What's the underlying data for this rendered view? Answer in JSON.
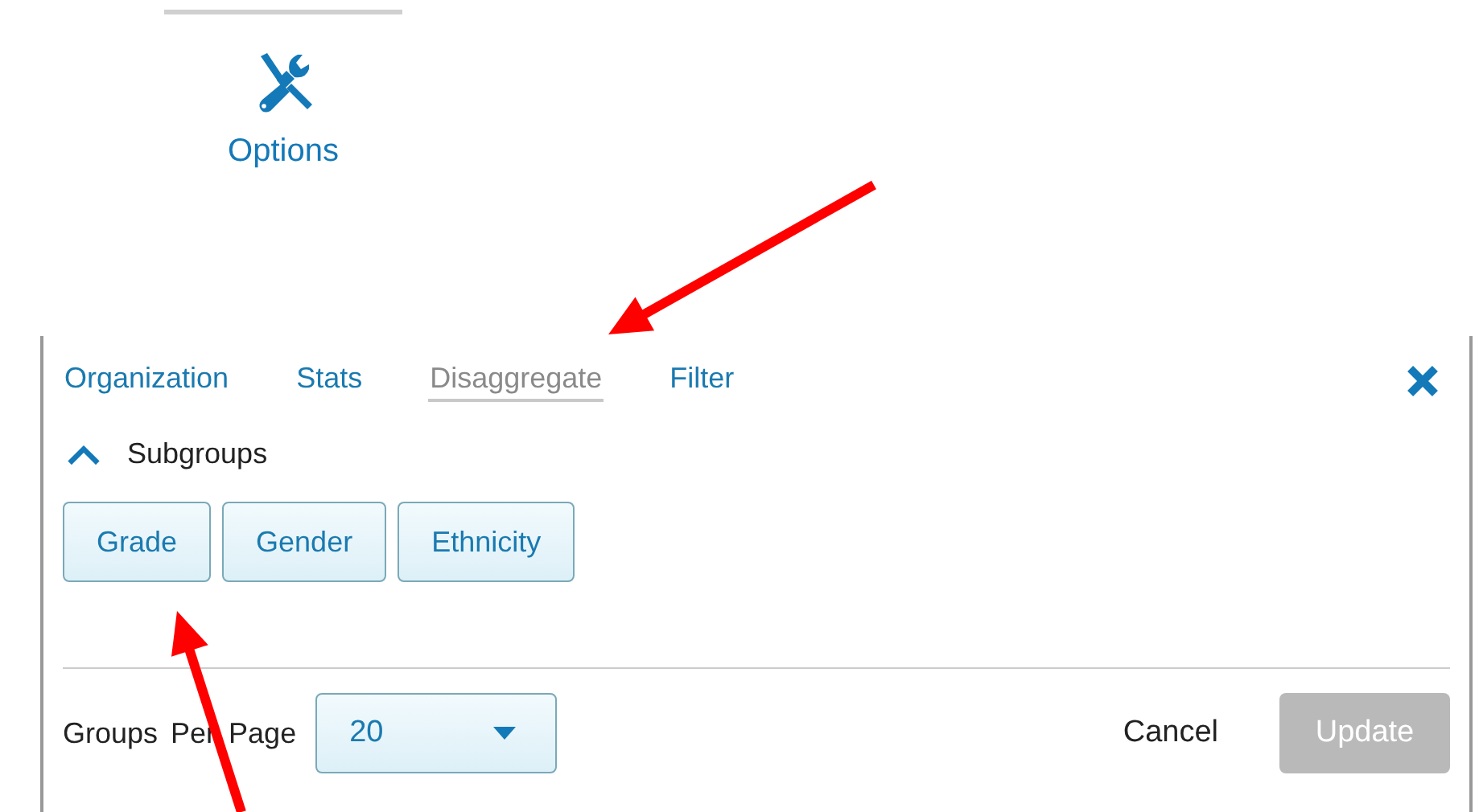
{
  "toolbar": {
    "label": "Options",
    "selected": true
  },
  "tabs": [
    {
      "label": "Organization",
      "selected": false
    },
    {
      "label": "Stats",
      "selected": false
    },
    {
      "label": "Disaggregate",
      "selected": true
    },
    {
      "label": "Filter",
      "selected": false
    }
  ],
  "section": {
    "title": "Subgroups",
    "expanded": true
  },
  "subgroups": [
    {
      "label": "Grade"
    },
    {
      "label": "Gender"
    },
    {
      "label": "Ethnicity"
    }
  ],
  "footer": {
    "label": "Groups Per Page",
    "select_value": "20",
    "cancel": "Cancel",
    "update": {
      "label": "Update",
      "disabled": true
    }
  },
  "annotations": [
    {
      "kind": "arrow"
    },
    {
      "kind": "arrow"
    }
  ]
}
